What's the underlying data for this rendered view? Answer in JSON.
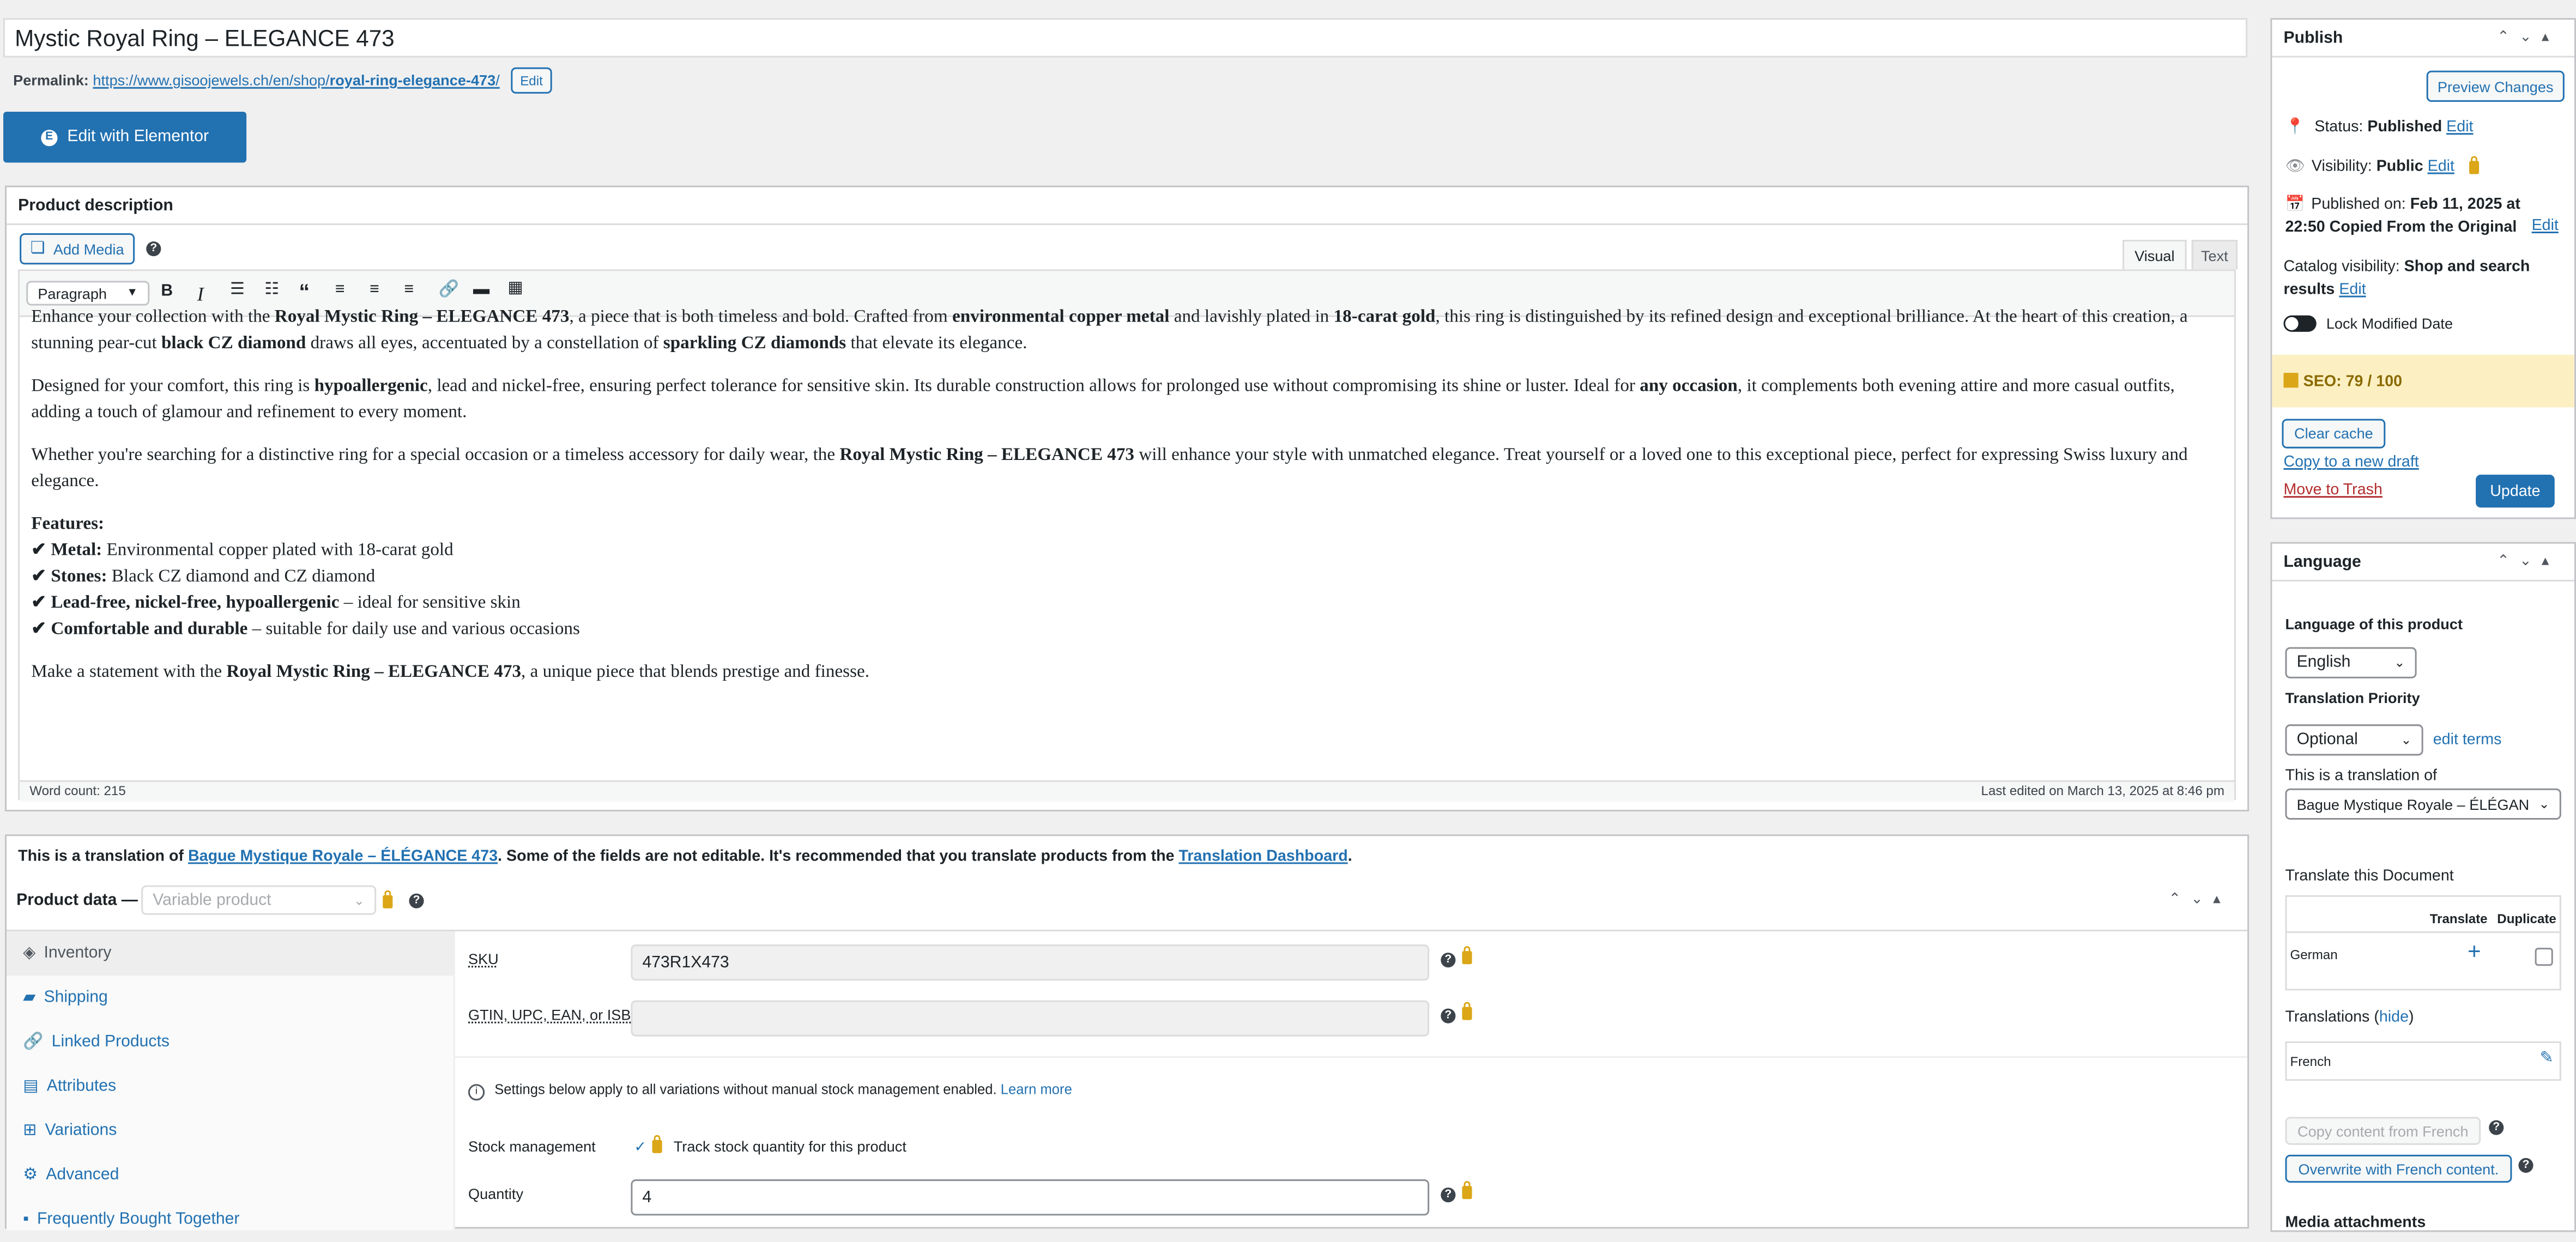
{
  "title": "Mystic Royal Ring – ELEGANCE 473",
  "permalink": {
    "label": "Permalink:",
    "url_base": "https://www.gisoojewels.ch/en/shop/",
    "url_slug": "royal-ring-elegance-473",
    "url_end": "/",
    "edit": "Edit"
  },
  "elementor_button": "Edit with Elementor",
  "description": {
    "heading": "Product description",
    "add_media": "Add Media",
    "help": "?",
    "tab_visual": "Visual",
    "tab_text": "Text",
    "format": "Paragraph",
    "p1": {
      "a": "Enhance your collection with the ",
      "b1": "Royal Mystic Ring – ELEGANCE 473",
      "c": ", a piece that is both timeless and bold. Crafted from ",
      "b2": "environmental copper metal",
      "d": " and lavishly plated in ",
      "b3": "18-carat gold",
      "e": ", this ring is distinguished by its refined design and exceptional brilliance. At the heart of this creation, a stunning pear-cut ",
      "b4": "black CZ diamond",
      "f": " draws all eyes, accentuated by a constellation of ",
      "b5": "sparkling CZ diamonds",
      "g": " that elevate its elegance."
    },
    "p2": {
      "a": "Designed for your comfort, this ring is ",
      "b1": "hypoallergenic",
      "c": ", lead and nickel-free, ensuring perfect tolerance for sensitive skin. Its durable construction allows for prolonged use without compromising its shine or luster. Ideal for ",
      "b2": "any occasion",
      "d": ", it complements both evening attire and more casual outfits, adding a touch of glamour and refinement to every moment."
    },
    "p3": {
      "a": "Whether you're searching for a distinctive ring for a special occasion or a timeless accessory for daily wear, the ",
      "b1": "Royal Mystic Ring – ELEGANCE 473",
      "c": " will enhance your style with unmatched elegance. Treat yourself or a loved one to this exceptional piece, perfect for expressing Swiss luxury and elegance."
    },
    "features_title": "Features:",
    "features": [
      {
        "label": "✔ Metal:",
        "text": " Environmental copper plated with 18-carat gold"
      },
      {
        "label": "✔ Stones:",
        "text": " Black CZ diamond and CZ diamond"
      },
      {
        "label": "✔ Lead-free, nickel-free, hypoallergenic",
        "text": " – ideal for sensitive skin"
      },
      {
        "label": "✔ Comfortable and durable",
        "text": " – suitable for daily use and various occasions"
      }
    ],
    "p4": {
      "a": "Make a statement with the ",
      "b1": "Royal Mystic Ring – ELEGANCE 473",
      "c": ", a unique piece that blends prestige and finesse."
    },
    "word_count": "Word count: 215",
    "last_edited": "Last edited on March 13, 2025 at 8:46 pm"
  },
  "translation_notice": {
    "a": "This is a translation of ",
    "link1": "Bague Mystique Royale – ÉLÉGANCE 473",
    "b": ". Some of the fields are not editable. It's recommended that you translate products from the ",
    "link2": "Translation Dashboard",
    "c": "."
  },
  "product_data": {
    "heading": "Product data —",
    "type": "Variable product",
    "tabs": [
      "Inventory",
      "Shipping",
      "Linked Products",
      "Attributes",
      "Variations",
      "Advanced",
      "Frequently Bought Together"
    ],
    "sku_label": "SKU",
    "sku_value": "473R1X473",
    "gtin_label": "GTIN, UPC, EAN, or ISBN",
    "gtin_value": "",
    "notice": "Settings below apply to all variations without manual stock management enabled.",
    "learn_more": "Learn more",
    "stock_label": "Stock management",
    "stock_text": "Track stock quantity for this product",
    "quantity_label": "Quantity",
    "quantity_value": "4"
  },
  "publish": {
    "heading": "Publish",
    "preview": "Preview Changes",
    "status_label": "Status:",
    "status_value": "Published",
    "visibility_label": "Visibility:",
    "visibility_value": "Public",
    "published_label": "Published on:",
    "published_value1": "Feb 11, 2025 at",
    "published_value2": "22:50 Copied From the Original",
    "catalog_label": "Catalog visibility:",
    "catalog_value1": "Shop and search",
    "catalog_value2": "results",
    "edit": "Edit",
    "lock_modified": "Lock Modified Date",
    "seo": "SEO: 79 / 100",
    "clear_cache": "Clear cache",
    "copy_draft": "Copy to a new draft",
    "trash": "Move to Trash",
    "update": "Update"
  },
  "language": {
    "heading": "Language",
    "lang_label": "Language of this product",
    "lang_value": "English",
    "priority_label": "Translation Priority",
    "priority_value": "Optional",
    "edit_terms": "edit terms",
    "translation_of_label": "This is a translation of",
    "translation_of_value": "Bague Mystique Royale – ÉLÉGAN",
    "translate_doc": "Translate this Document",
    "col_translate": "Translate",
    "col_duplicate": "Duplicate",
    "row_lang": "German",
    "translations_label": "Translations (",
    "hide": "hide",
    "translations_close": ")",
    "french": "French",
    "copy_content": "Copy content from French",
    "overwrite": "Overwrite with French content.",
    "media_attachments": "Media attachments"
  }
}
